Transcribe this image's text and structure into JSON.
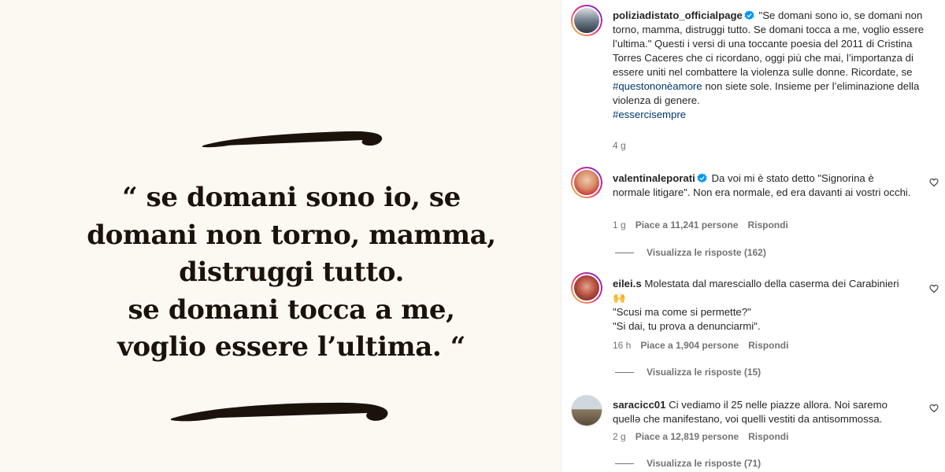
{
  "post": {
    "quote_lines": [
      "“ se domani sono io, se",
      "domani non torno, mamma,",
      "distruggi tutto.",
      "se domani tocca a me,",
      "voglio essere l’ultima. “"
    ]
  },
  "caption": {
    "username": "poliziadistato_officialpage",
    "verified": true,
    "text_1": "\"Se domani sono io, se domani non torno, mamma, distruggi tutto. Se domani tocca a me, voglio essere l’ultima.\" Questi i versi di una toccante poesia del 2011 di Cristina Torres Caceres che ci ricordano, oggi più che mai, l’importanza di essere uniti nel combattere la violenza sulle donne. Ricordate, se ",
    "hashtag_1": "#questononèamore",
    "text_2": " non siete sole. Insieme per l’eliminazione della violenza di genere.",
    "hashtag_2": "#essercisempre",
    "time": "4 g"
  },
  "comments": [
    {
      "username": "valentinaleporati",
      "verified": true,
      "text": "Da voi mi è stato detto \"Signorina è normale litigare\". Non era normale, ed era davanti ai vostri occhi.",
      "time": "1 g",
      "likes": "Piace a 11,241 persone",
      "reply": "Rispondi",
      "view_replies": "Visualizza le risposte (162)"
    },
    {
      "username": "eilei.s",
      "verified": false,
      "text": "Molestata dal maresciallo della caserma dei Carabinieri 🙌",
      "text_line_2": "\"Scusi ma come si permette?\"",
      "text_line_3": "\"Si dai, tu prova a denunciarmi\".",
      "time": "16 h",
      "likes": "Piace a 1,904 persone",
      "reply": "Rispondi",
      "view_replies": "Visualizza le risposte (15)"
    },
    {
      "username": "saracicc01",
      "verified": false,
      "text": "Ci vediamo il 25 nelle piazze allora. Noi saremo quellə che manifestano, voi quelli vestiti da antisommossa.",
      "time": "2 g",
      "likes": "Piace a 12,819 persone",
      "reply": "Rispondi",
      "view_replies": "Visualizza le risposte (71)"
    }
  ],
  "colors": {
    "post_background": "#fcf9f3",
    "quote_text": "#1c120c",
    "hashtag": "#00376b",
    "verified_badge": "#0095f6",
    "muted": "#737373"
  }
}
